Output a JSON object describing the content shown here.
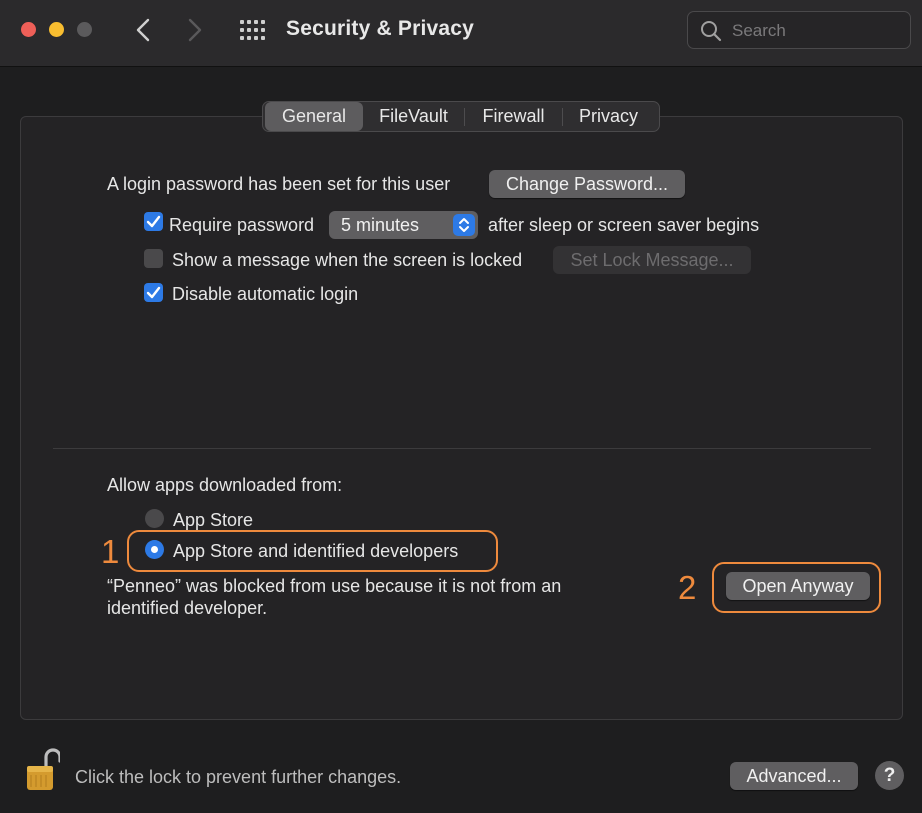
{
  "window": {
    "title": "Security & Privacy",
    "search_placeholder": "Search"
  },
  "tabs": [
    {
      "label": "General",
      "active": true
    },
    {
      "label": "FileVault",
      "active": false
    },
    {
      "label": "Firewall",
      "active": false
    },
    {
      "label": "Privacy",
      "active": false
    }
  ],
  "general": {
    "login_password_text": "A login password has been set for this user",
    "change_password_label": "Change Password...",
    "require_password": {
      "label": "Require password",
      "checked": true
    },
    "require_password_delay": "5 minutes",
    "require_password_suffix": "after sleep or screen saver begins",
    "show_message": {
      "label": "Show a message when the screen is locked",
      "checked": false
    },
    "set_lock_message_label": "Set Lock Message...",
    "disable_auto_login": {
      "label": "Disable automatic login",
      "checked": true
    }
  },
  "allow_apps": {
    "heading": "Allow apps downloaded from:",
    "options": [
      {
        "label": "App Store",
        "selected": false
      },
      {
        "label": "App Store and identified developers",
        "selected": true
      }
    ],
    "blocked_message_line1": "“Penneo” was blocked from use because it is not from an",
    "blocked_message_line2": "identified developer.",
    "open_anyway_label": "Open Anyway"
  },
  "annotations": {
    "marker_1": "1",
    "marker_2": "2",
    "highlight_color": "#ee8a3d"
  },
  "footer": {
    "lock_text": "Click the lock to prevent further changes.",
    "advanced_label": "Advanced...",
    "help_label": "?"
  },
  "colors": {
    "accent": "#2d7ae6",
    "background": "#1e1e1f",
    "panel": "#242325"
  }
}
